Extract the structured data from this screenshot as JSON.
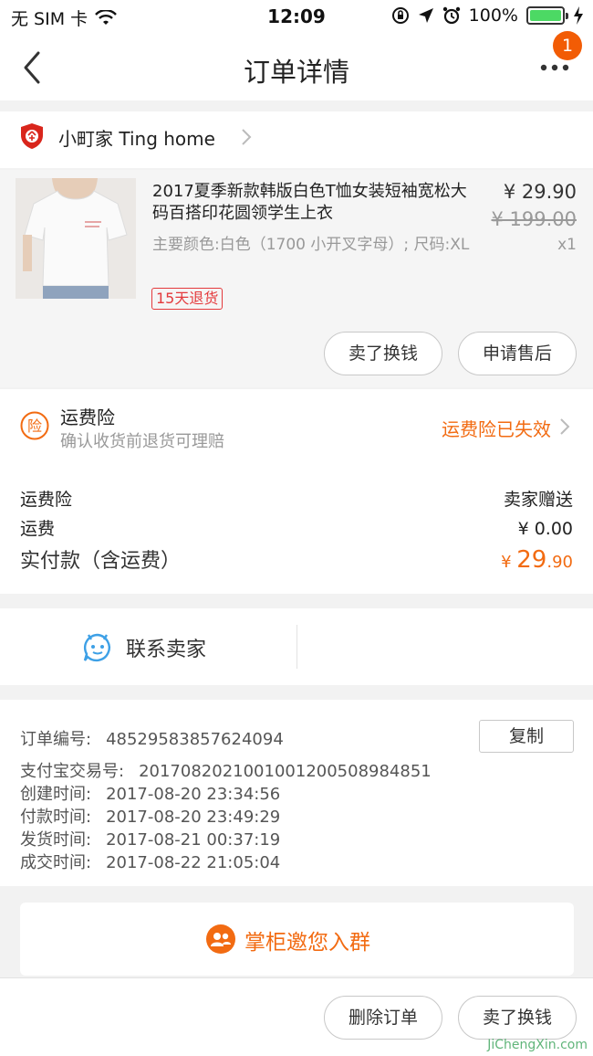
{
  "status_bar": {
    "carrier": "无 SIM 卡",
    "time": "12:09",
    "battery": "100%"
  },
  "nav": {
    "title": "订单详情",
    "badge": "1"
  },
  "shop": {
    "name": "小町家  Ting home"
  },
  "product": {
    "title": "2017夏季新款韩版白色T恤女装短袖宽松大码百搭印花圆领学生上衣",
    "spec": "主要颜色:白色（1700 小开叉字母）; 尺码:XL",
    "tag": "15天退货",
    "price": "¥ 29.90",
    "original_price": "¥ 199.00",
    "quantity": "x1",
    "buttons": {
      "resell": "卖了换钱",
      "after_sale": "申请售后"
    }
  },
  "insurance": {
    "icon_char": "险",
    "title": "运费险",
    "subtitle": "确认收货前退货可理赔",
    "status": "运费险已失效"
  },
  "fees": {
    "rows": [
      {
        "label": "运费险",
        "value": "卖家赠送"
      },
      {
        "label": "运费",
        "value": "¥ 0.00"
      }
    ],
    "total_label": "实付款（含运费）",
    "total_currency": "¥ ",
    "total_int": "29",
    "total_dec": ".90"
  },
  "contact": {
    "label": "联系卖家"
  },
  "order_info": {
    "copy_label": "复制",
    "rows": [
      {
        "label": "订单编号:",
        "value": "48529583857624094"
      },
      {
        "label": "支付宝交易号:",
        "value": "2017082021001001200508984851"
      },
      {
        "label": "创建时间:",
        "value": "2017-08-20 23:34:56"
      },
      {
        "label": "付款时间:",
        "value": "2017-08-20 23:49:29"
      },
      {
        "label": "发货时间:",
        "value": "2017-08-21 00:37:19"
      },
      {
        "label": "成交时间:",
        "value": "2017-08-22 21:05:04"
      }
    ]
  },
  "group": {
    "label": "掌柜邀您入群"
  },
  "bottom_bar": {
    "delete_order": "删除订单",
    "resell": "卖了换钱"
  },
  "watermark": "JiChengXin.com",
  "colors": {
    "accent": "#f26b12",
    "badge": "#f25c05",
    "tag": "#e4393c",
    "contact_icon": "#3da0e6",
    "battery": "#4cd964"
  }
}
